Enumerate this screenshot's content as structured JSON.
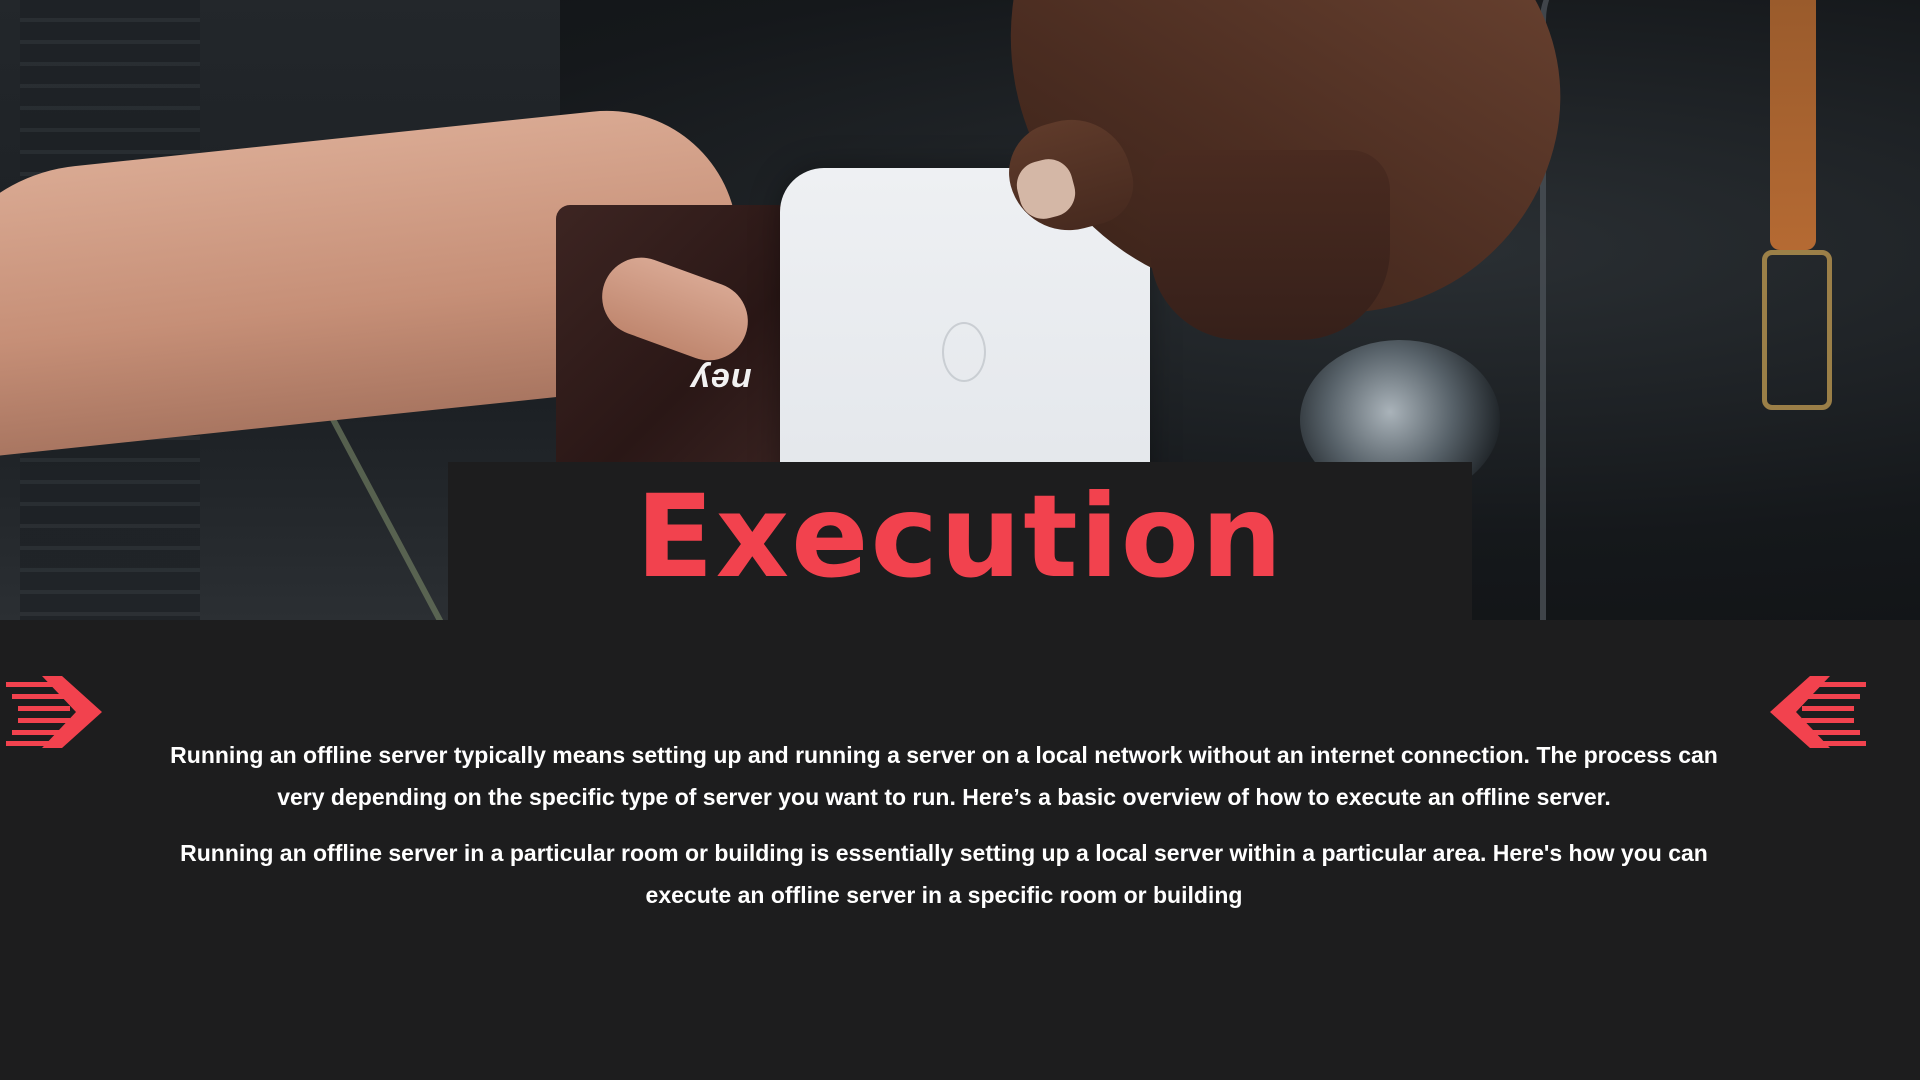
{
  "slide": {
    "title": "Execution",
    "accent_color": "#f2424e",
    "background_color": "#1d1d1e",
    "paragraphs": [
      "Running an offline server typically means setting up and running a server on a local network without an internet connection. The process can very depending on the specific type of server you want to run. Here’s a basic overview of how to execute an offline server.",
      "Running an offline server in a particular room or building is essentially setting up a local server within a particular area. Here's how you can execute an offline server in a specific room or building"
    ]
  },
  "hero_image": {
    "subject": "hands-exchanging-card-at-payment-reader",
    "card_text": "ney"
  },
  "decorations": {
    "left_icon": "chevron-right-speed-icon",
    "right_icon": "chevron-left-speed-icon"
  }
}
